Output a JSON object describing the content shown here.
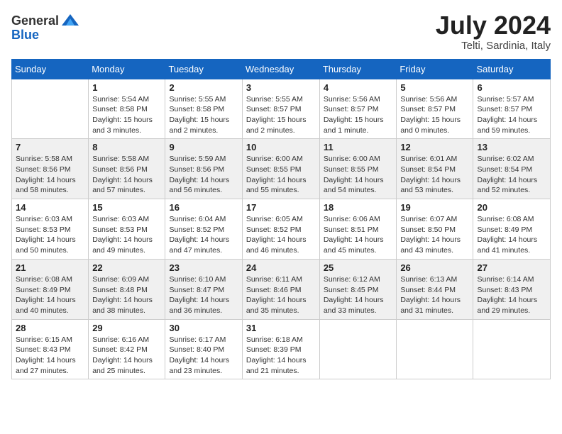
{
  "header": {
    "logo_general": "General",
    "logo_blue": "Blue",
    "month_year": "July 2024",
    "location": "Telti, Sardinia, Italy"
  },
  "weekdays": [
    "Sunday",
    "Monday",
    "Tuesday",
    "Wednesday",
    "Thursday",
    "Friday",
    "Saturday"
  ],
  "weeks": [
    [
      {
        "day": "",
        "info": ""
      },
      {
        "day": "1",
        "info": "Sunrise: 5:54 AM\nSunset: 8:58 PM\nDaylight: 15 hours and 3 minutes."
      },
      {
        "day": "2",
        "info": "Sunrise: 5:55 AM\nSunset: 8:58 PM\nDaylight: 15 hours and 2 minutes."
      },
      {
        "day": "3",
        "info": "Sunrise: 5:55 AM\nSunset: 8:57 PM\nDaylight: 15 hours and 2 minutes."
      },
      {
        "day": "4",
        "info": "Sunrise: 5:56 AM\nSunset: 8:57 PM\nDaylight: 15 hours and 1 minute."
      },
      {
        "day": "5",
        "info": "Sunrise: 5:56 AM\nSunset: 8:57 PM\nDaylight: 15 hours and 0 minutes."
      },
      {
        "day": "6",
        "info": "Sunrise: 5:57 AM\nSunset: 8:57 PM\nDaylight: 14 hours and 59 minutes."
      }
    ],
    [
      {
        "day": "7",
        "info": "Sunrise: 5:58 AM\nSunset: 8:56 PM\nDaylight: 14 hours and 58 minutes."
      },
      {
        "day": "8",
        "info": "Sunrise: 5:58 AM\nSunset: 8:56 PM\nDaylight: 14 hours and 57 minutes."
      },
      {
        "day": "9",
        "info": "Sunrise: 5:59 AM\nSunset: 8:56 PM\nDaylight: 14 hours and 56 minutes."
      },
      {
        "day": "10",
        "info": "Sunrise: 6:00 AM\nSunset: 8:55 PM\nDaylight: 14 hours and 55 minutes."
      },
      {
        "day": "11",
        "info": "Sunrise: 6:00 AM\nSunset: 8:55 PM\nDaylight: 14 hours and 54 minutes."
      },
      {
        "day": "12",
        "info": "Sunrise: 6:01 AM\nSunset: 8:54 PM\nDaylight: 14 hours and 53 minutes."
      },
      {
        "day": "13",
        "info": "Sunrise: 6:02 AM\nSunset: 8:54 PM\nDaylight: 14 hours and 52 minutes."
      }
    ],
    [
      {
        "day": "14",
        "info": "Sunrise: 6:03 AM\nSunset: 8:53 PM\nDaylight: 14 hours and 50 minutes."
      },
      {
        "day": "15",
        "info": "Sunrise: 6:03 AM\nSunset: 8:53 PM\nDaylight: 14 hours and 49 minutes."
      },
      {
        "day": "16",
        "info": "Sunrise: 6:04 AM\nSunset: 8:52 PM\nDaylight: 14 hours and 47 minutes."
      },
      {
        "day": "17",
        "info": "Sunrise: 6:05 AM\nSunset: 8:52 PM\nDaylight: 14 hours and 46 minutes."
      },
      {
        "day": "18",
        "info": "Sunrise: 6:06 AM\nSunset: 8:51 PM\nDaylight: 14 hours and 45 minutes."
      },
      {
        "day": "19",
        "info": "Sunrise: 6:07 AM\nSunset: 8:50 PM\nDaylight: 14 hours and 43 minutes."
      },
      {
        "day": "20",
        "info": "Sunrise: 6:08 AM\nSunset: 8:49 PM\nDaylight: 14 hours and 41 minutes."
      }
    ],
    [
      {
        "day": "21",
        "info": "Sunrise: 6:08 AM\nSunset: 8:49 PM\nDaylight: 14 hours and 40 minutes."
      },
      {
        "day": "22",
        "info": "Sunrise: 6:09 AM\nSunset: 8:48 PM\nDaylight: 14 hours and 38 minutes."
      },
      {
        "day": "23",
        "info": "Sunrise: 6:10 AM\nSunset: 8:47 PM\nDaylight: 14 hours and 36 minutes."
      },
      {
        "day": "24",
        "info": "Sunrise: 6:11 AM\nSunset: 8:46 PM\nDaylight: 14 hours and 35 minutes."
      },
      {
        "day": "25",
        "info": "Sunrise: 6:12 AM\nSunset: 8:45 PM\nDaylight: 14 hours and 33 minutes."
      },
      {
        "day": "26",
        "info": "Sunrise: 6:13 AM\nSunset: 8:44 PM\nDaylight: 14 hours and 31 minutes."
      },
      {
        "day": "27",
        "info": "Sunrise: 6:14 AM\nSunset: 8:43 PM\nDaylight: 14 hours and 29 minutes."
      }
    ],
    [
      {
        "day": "28",
        "info": "Sunrise: 6:15 AM\nSunset: 8:43 PM\nDaylight: 14 hours and 27 minutes."
      },
      {
        "day": "29",
        "info": "Sunrise: 6:16 AM\nSunset: 8:42 PM\nDaylight: 14 hours and 25 minutes."
      },
      {
        "day": "30",
        "info": "Sunrise: 6:17 AM\nSunset: 8:40 PM\nDaylight: 14 hours and 23 minutes."
      },
      {
        "day": "31",
        "info": "Sunrise: 6:18 AM\nSunset: 8:39 PM\nDaylight: 14 hours and 21 minutes."
      },
      {
        "day": "",
        "info": ""
      },
      {
        "day": "",
        "info": ""
      },
      {
        "day": "",
        "info": ""
      }
    ]
  ]
}
